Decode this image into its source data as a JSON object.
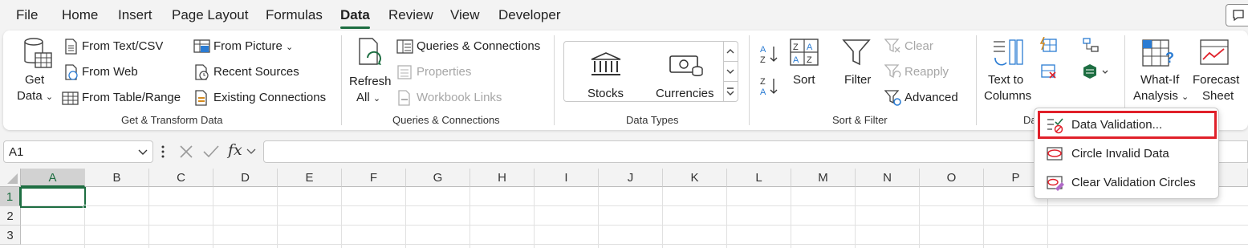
{
  "menu": {
    "items": [
      "File",
      "Home",
      "Insert",
      "Page Layout",
      "Formulas",
      "Data",
      "Review",
      "View",
      "Developer"
    ],
    "active": "Data"
  },
  "ribbon": {
    "get_transform": {
      "get_data": [
        "Get",
        "Data"
      ],
      "from_text_csv": "From Text/CSV",
      "from_web": "From Web",
      "from_table_range": "From Table/Range",
      "from_picture": "From Picture",
      "recent_sources": "Recent Sources",
      "existing_connections": "Existing Connections",
      "label": "Get & Transform Data"
    },
    "queries": {
      "refresh_all": [
        "Refresh",
        "All"
      ],
      "queries_connections": "Queries & Connections",
      "properties": "Properties",
      "workbook_links": "Workbook Links",
      "label": "Queries & Connections"
    },
    "data_types": {
      "stocks": "Stocks",
      "currencies": "Currencies",
      "label": "Data Types"
    },
    "sort_filter": {
      "sort": "Sort",
      "filter": "Filter",
      "clear": "Clear",
      "reapply": "Reapply",
      "advanced": "Advanced",
      "label": "Sort & Filter"
    },
    "data_tools": {
      "text_to_columns": [
        "Text to",
        "Columns"
      ],
      "label": "Da"
    },
    "forecast": {
      "what_if": [
        "What-If",
        "Analysis"
      ],
      "forecast_sheet": [
        "Forecast",
        "Sheet"
      ]
    }
  },
  "formula_bar": {
    "name_box": "A1",
    "fx": "fx",
    "value": ""
  },
  "grid": {
    "columns": [
      "A",
      "B",
      "C",
      "D",
      "E",
      "F",
      "G",
      "H",
      "I",
      "J",
      "K",
      "L",
      "M",
      "N",
      "O",
      "P"
    ],
    "rows": [
      "1",
      "2",
      "3"
    ],
    "selected_column": "A",
    "selected_row": "1"
  },
  "dropdown": {
    "items": [
      "Data Validation...",
      "Circle Invalid Data",
      "Clear Validation Circles"
    ],
    "highlighted": "Data Validation..."
  },
  "colors": {
    "accent_green": "#1e6e42",
    "highlight_red": "#e0202a",
    "icon_blue": "#2b7cd3"
  }
}
